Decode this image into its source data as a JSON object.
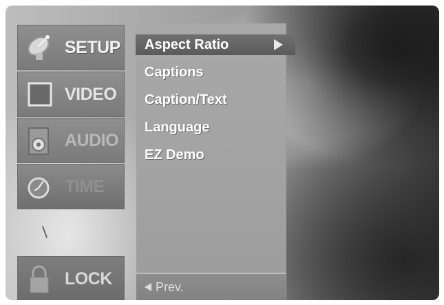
{
  "menu_tabs": [
    {
      "id": "setup",
      "label": "SETUP",
      "icon": "satellite-dish-icon"
    },
    {
      "id": "video",
      "label": "VIDEO",
      "icon": "screen-icon"
    },
    {
      "id": "audio",
      "label": "AUDIO",
      "icon": "speaker-icon"
    },
    {
      "id": "time",
      "label": "TIME",
      "icon": "clock-icon"
    },
    {
      "id": "lock",
      "label": "LOCK",
      "icon": "padlock-icon"
    }
  ],
  "submenu": {
    "items": [
      {
        "label": "Aspect Ratio",
        "selected": true
      },
      {
        "label": "Captions"
      },
      {
        "label": "Caption/Text"
      },
      {
        "label": "Language"
      },
      {
        "label": "EZ Demo"
      }
    ],
    "prev_label": "Prev.",
    "selected_arrow_icon": "right-arrow-icon",
    "prev_arrow_icon": "left-arrow-icon"
  }
}
